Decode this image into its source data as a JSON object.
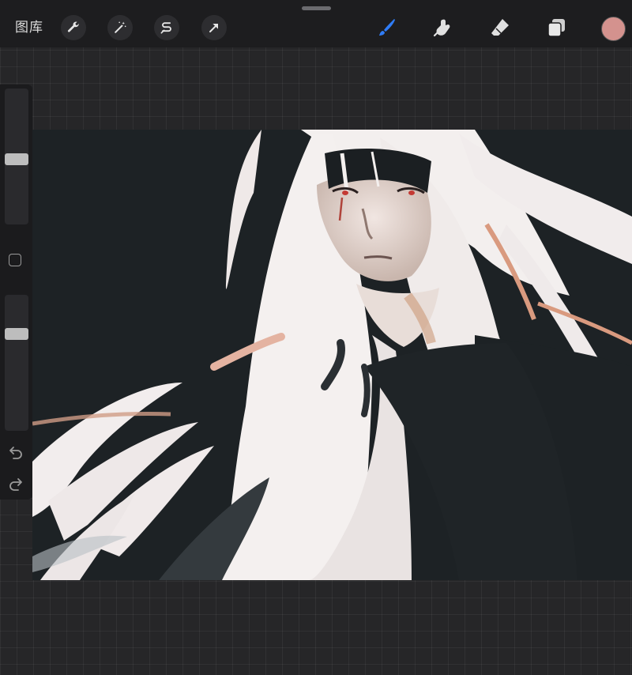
{
  "topbar": {
    "gallery_label": "图库",
    "left_tools": [
      {
        "icon": "wrench-icon"
      },
      {
        "icon": "magic-wand-icon"
      },
      {
        "icon": "selection-s-icon"
      },
      {
        "icon": "transform-arrow-icon"
      }
    ],
    "right_tools": [
      {
        "icon": "brush-icon",
        "active": true
      },
      {
        "icon": "smudge-icon"
      },
      {
        "icon": "eraser-icon"
      },
      {
        "icon": "layers-icon"
      }
    ],
    "current_color": "#d4928e"
  },
  "sidebar": {
    "brush_size_level": 0.48,
    "opacity_level": 0.73,
    "undo_icon": "undo-icon",
    "redo_icon": "redo-icon"
  },
  "canvas": {
    "artwork": "painting-portrait"
  },
  "colors": {
    "accent": "#2f7cf6",
    "toolbar_bg": "#1d1d1f",
    "canvas_bg": "#1d2225"
  }
}
